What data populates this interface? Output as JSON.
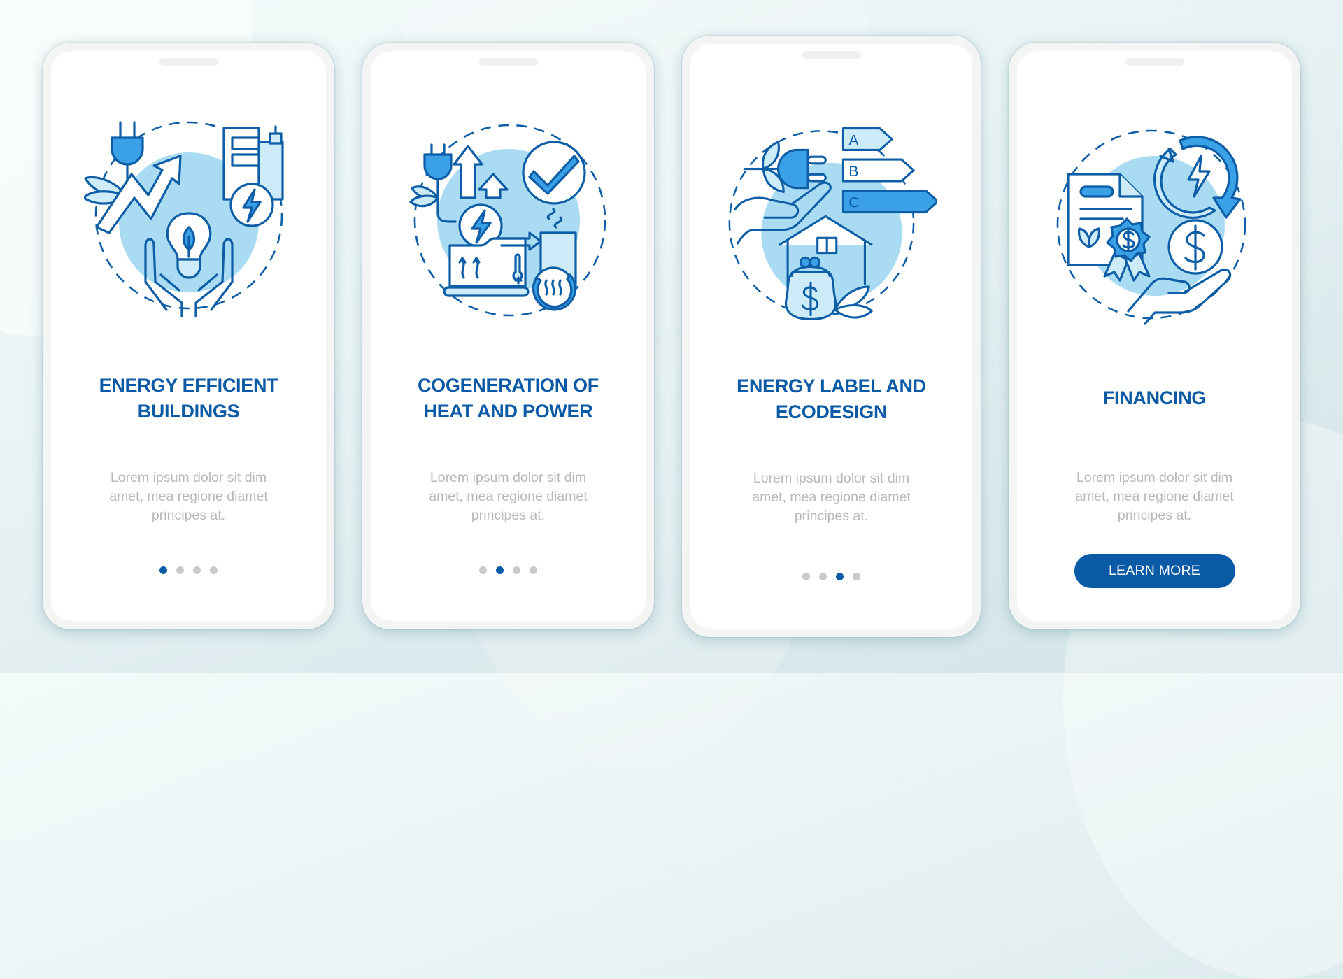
{
  "theme": {
    "accent": "#0b5aa6",
    "illustration_light": "#a9dcf3",
    "illustration_mid": "#3aa1e6",
    "body_text": "#b8b8b8",
    "dot_inactive": "#c9c9c9"
  },
  "cards": [
    {
      "illustration": "energy-efficient-buildings-illustration",
      "title_lines": [
        "ENERGY EFFICIENT",
        "BUILDINGS"
      ],
      "body_lines": [
        "Lorem ipsum dolor sit dim",
        "amet, mea regione diamet",
        "principes at."
      ],
      "pagination": {
        "total": 4,
        "active_index": 0
      }
    },
    {
      "illustration": "cogeneration-heat-power-illustration",
      "title_lines": [
        "COGENERATION OF",
        "HEAT AND POWER"
      ],
      "body_lines": [
        "Lorem ipsum dolor sit dim",
        "amet, mea regione diamet",
        "principes at."
      ],
      "pagination": {
        "total": 4,
        "active_index": 1
      }
    },
    {
      "illustration": "energy-label-ecodesign-illustration",
      "title_lines": [
        "ENERGY LABEL AND",
        "ECODESIGN"
      ],
      "body_lines": [
        "Lorem ipsum dolor sit dim",
        "amet, mea regione diamet",
        "principes at."
      ],
      "energy_labels": [
        "A",
        "B",
        "C"
      ],
      "pagination": {
        "total": 4,
        "active_index": 2
      }
    },
    {
      "illustration": "financing-illustration",
      "title_lines": [
        "FINANCING"
      ],
      "body_lines": [
        "Lorem ipsum dolor sit dim",
        "amet, mea regione diamet",
        "principes at."
      ],
      "button_label": "LEARN MORE"
    }
  ]
}
